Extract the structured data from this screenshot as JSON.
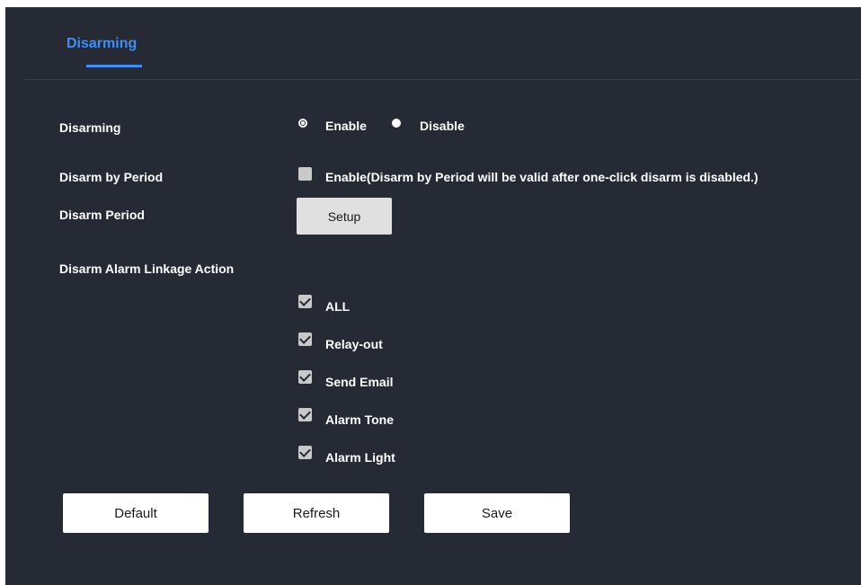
{
  "tab": {
    "label": "Disarming"
  },
  "disarming": {
    "label": "Disarming",
    "options": [
      {
        "label": "Enable",
        "selected": true
      },
      {
        "label": "Disable",
        "selected": false
      }
    ]
  },
  "disarm_by_period": {
    "label": "Disarm by Period",
    "checkbox_label": "Enable(Disarm by Period will be valid after one-click disarm is disabled.)",
    "checked": false
  },
  "disarm_period": {
    "label": "Disarm Period",
    "button_label": "Setup"
  },
  "linkage": {
    "label": "Disarm Alarm Linkage Action",
    "items": [
      {
        "label": "ALL",
        "checked": true
      },
      {
        "label": "Relay-out",
        "checked": true
      },
      {
        "label": "Send Email",
        "checked": true
      },
      {
        "label": "Alarm Tone",
        "checked": true
      },
      {
        "label": "Alarm Light",
        "checked": true
      }
    ]
  },
  "buttons": {
    "default": "Default",
    "refresh": "Refresh",
    "save": "Save"
  },
  "colors": {
    "background": "#252a35",
    "accent": "#3e8ef7",
    "text": "#ffffff",
    "button": "#ffffff"
  }
}
